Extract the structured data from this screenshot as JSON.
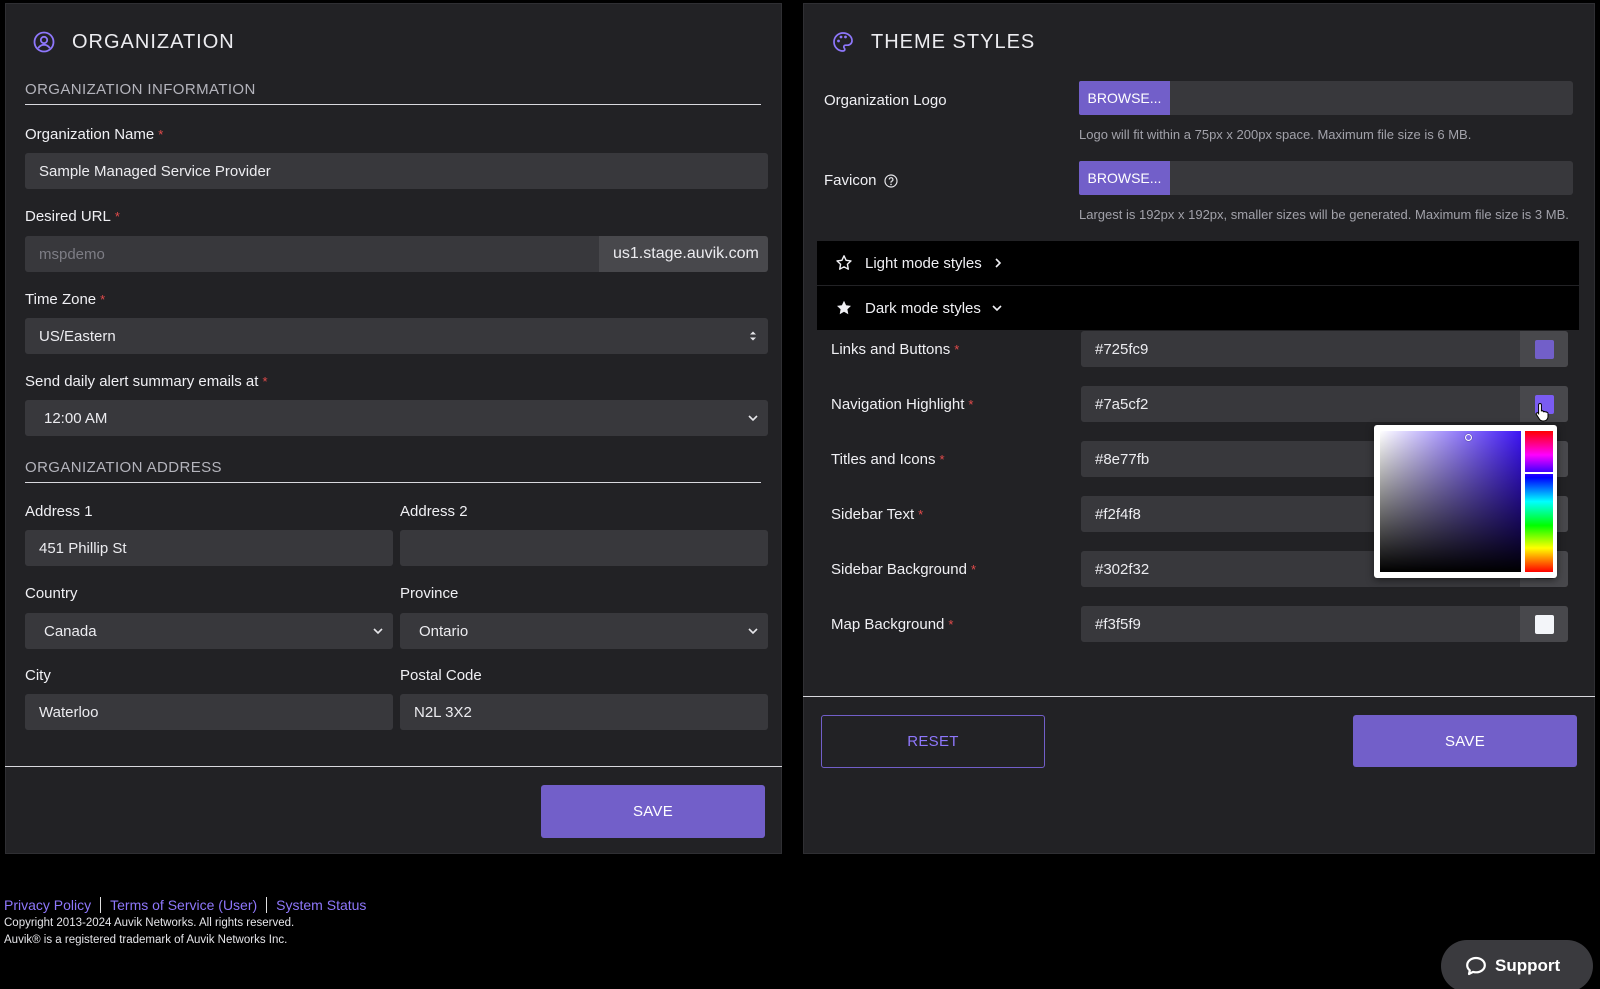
{
  "organization": {
    "title": "ORGANIZATION",
    "info_section": "ORGANIZATION INFORMATION",
    "org_name_label": "Organization Name",
    "org_name_value": "Sample Managed Service Provider",
    "url_label": "Desired URL",
    "url_placeholder": "mspdemo",
    "url_suffix": "us1.stage.auvik.com",
    "timezone_label": "Time Zone",
    "timezone_value": "US/Eastern",
    "alert_label": "Send daily alert summary emails at",
    "alert_value": "12:00 AM",
    "address_section": "ORGANIZATION ADDRESS",
    "address1_label": "Address 1",
    "address1_value": "451 Phillip St",
    "address2_label": "Address 2",
    "address2_value": "",
    "country_label": "Country",
    "country_value": "Canada",
    "province_label": "Province",
    "province_value": "Ontario",
    "city_label": "City",
    "city_value": "Waterloo",
    "postal_label": "Postal Code",
    "postal_value": "N2L 3X2",
    "required_mark": "*",
    "save_label": "SAVE"
  },
  "theme": {
    "title": "THEME STYLES",
    "logo_label": "Organization Logo",
    "browse_label": "BROWSE...",
    "logo_hint": "Logo will fit within a 75px x 200px space. Maximum file size is 6 MB.",
    "favicon_label": "Favicon",
    "favicon_hint": "Largest is 192px x 192px, smaller sizes will be generated. Maximum file size is 3 MB.",
    "light_mode_label": "Light mode styles",
    "dark_mode_label": "Dark mode styles",
    "colors": [
      {
        "label": "Links and Buttons",
        "value": "#725fc9",
        "swatch": "#725fc9"
      },
      {
        "label": "Navigation Highlight",
        "value": "#7a5cf2",
        "swatch": "#7a5cf2"
      },
      {
        "label": "Titles and Icons",
        "value": "#8e77fb",
        "swatch": "#8e77fb"
      },
      {
        "label": "Sidebar Text",
        "value": "#f2f4f8",
        "swatch": "#f2f4f8"
      },
      {
        "label": "Sidebar Background",
        "value": "#302f32",
        "swatch": "#302f32"
      },
      {
        "label": "Map Background",
        "value": "#f3f5f9",
        "swatch": "#f3f5f9"
      }
    ],
    "reset_label": "RESET",
    "save_label": "SAVE"
  },
  "footer": {
    "privacy": "Privacy Policy",
    "terms": "Terms of Service (User)",
    "status": "System Status",
    "copyright": "Copyright 2013-2024 Auvik Networks. All rights reserved.",
    "trademark": "Auvik® is a registered trademark of Auvik Networks Inc."
  },
  "support": {
    "label": "Support"
  },
  "accent_colors": {
    "primary": "#725fc9",
    "title_icons": "#8e77fb",
    "required": "#e34b4b"
  }
}
